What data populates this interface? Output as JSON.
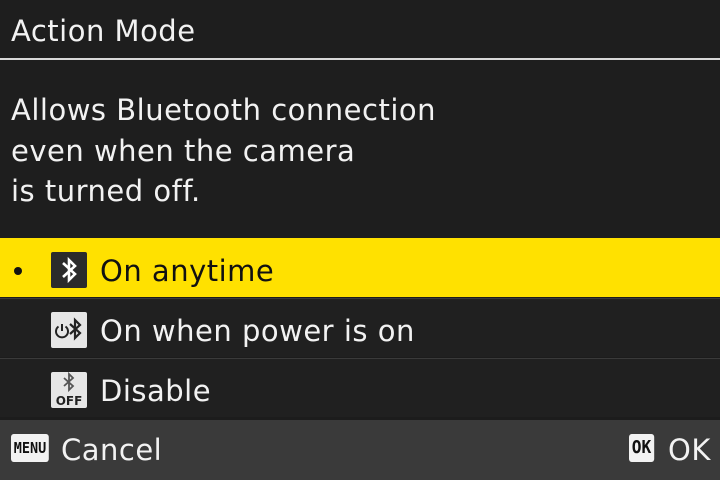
{
  "screen": {
    "title": "Action Mode",
    "description": [
      "Allows Bluetooth connection",
      "even when the camera",
      "is turned off."
    ]
  },
  "options": [
    {
      "label": "On anytime",
      "icon": "bluetooth-icon",
      "selected": true
    },
    {
      "label": "On when power is on",
      "icon": "power-bluetooth-icon",
      "selected": false
    },
    {
      "label": "Disable",
      "icon": "bluetooth-off-icon",
      "icon_text": "OFF",
      "selected": false
    }
  ],
  "footer": {
    "menu_key": "MENU",
    "cancel_label": "Cancel",
    "ok_key": "OK",
    "ok_label": "OK"
  },
  "colors": {
    "selection": "#ffe100",
    "background": "#1c1c1c",
    "footer": "#3a3a3a"
  }
}
